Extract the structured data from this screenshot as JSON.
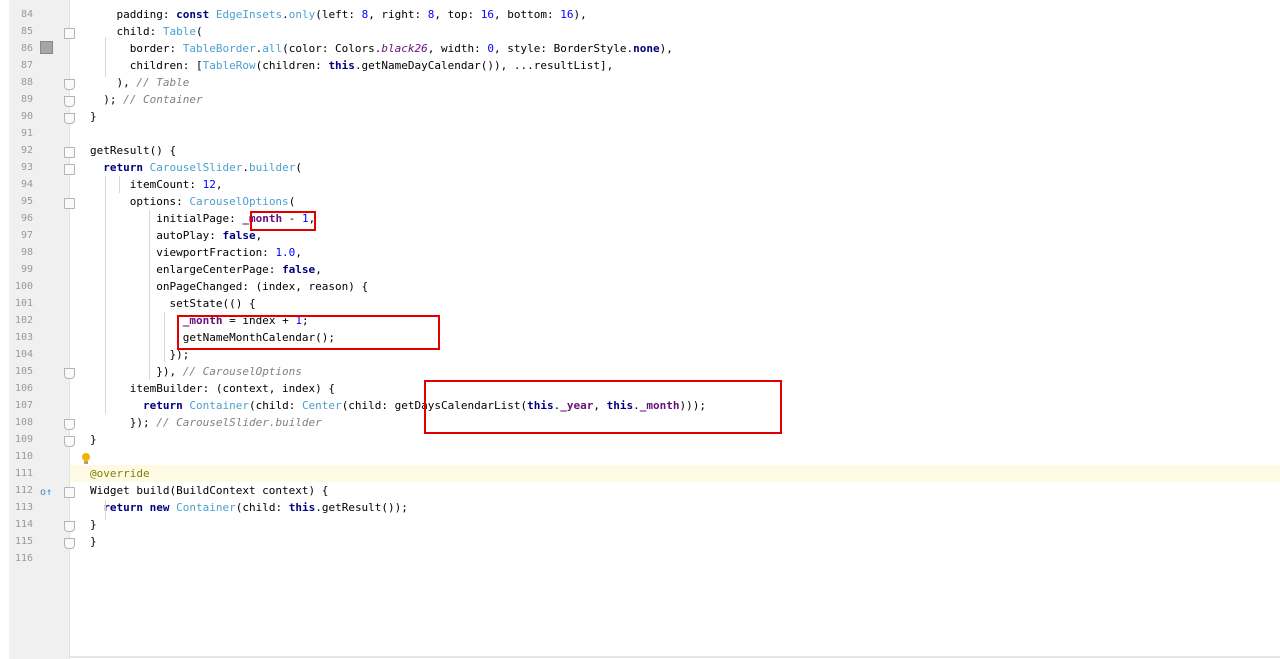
{
  "editor": {
    "lines": [
      {
        "n": "84",
        "segs": [
          [
            "",
            "    padding: "
          ],
          [
            "kw",
            "const "
          ],
          [
            "cls",
            "EdgeInsets"
          ],
          [
            "",
            "."
          ],
          [
            "cls",
            "only"
          ],
          [
            "",
            "(left: "
          ],
          [
            "num",
            "8"
          ],
          [
            "",
            ", right: "
          ],
          [
            "num",
            "8"
          ],
          [
            "",
            ", top: "
          ],
          [
            "num",
            "16"
          ],
          [
            "",
            ", bottom: "
          ],
          [
            "num",
            "16"
          ],
          [
            "",
            "),"
          ]
        ]
      },
      {
        "n": "85",
        "segs": [
          [
            "",
            "    child: "
          ],
          [
            "cls",
            "Table"
          ],
          [
            "",
            "("
          ]
        ]
      },
      {
        "n": "86",
        "segs": [
          [
            "",
            "      border: "
          ],
          [
            "cls",
            "TableBorder"
          ],
          [
            "",
            "."
          ],
          [
            "cls",
            "all"
          ],
          [
            "",
            "(color: Colors."
          ],
          [
            "ital",
            "black26"
          ],
          [
            "",
            ", width: "
          ],
          [
            "num",
            "0"
          ],
          [
            "",
            ", style: BorderStyle."
          ],
          [
            "kw",
            "none"
          ],
          [
            "",
            "),"
          ]
        ]
      },
      {
        "n": "87",
        "segs": [
          [
            "",
            "      children: ["
          ],
          [
            "cls",
            "TableRow"
          ],
          [
            "",
            "(children: "
          ],
          [
            "kw",
            "this"
          ],
          [
            "",
            ".getNameDayCalendar()), ...resultList],"
          ]
        ]
      },
      {
        "n": "88",
        "segs": [
          [
            "",
            "    ), "
          ],
          [
            "cm",
            "// Table"
          ]
        ]
      },
      {
        "n": "89",
        "segs": [
          [
            "",
            "  ); "
          ],
          [
            "cm",
            "// Container"
          ]
        ]
      },
      {
        "n": "90",
        "segs": [
          [
            "",
            "}"
          ]
        ]
      },
      {
        "n": "91",
        "segs": [
          [
            "",
            ""
          ]
        ]
      },
      {
        "n": "92",
        "segs": [
          [
            "",
            "getResult() {"
          ]
        ]
      },
      {
        "n": "93",
        "segs": [
          [
            "",
            "  "
          ],
          [
            "kw",
            "return "
          ],
          [
            "cls",
            "CarouselSlider"
          ],
          [
            "",
            "."
          ],
          [
            "cls",
            "builder"
          ],
          [
            "",
            "("
          ]
        ]
      },
      {
        "n": "94",
        "segs": [
          [
            "",
            "      itemCount: "
          ],
          [
            "num",
            "12"
          ],
          [
            "",
            ","
          ]
        ]
      },
      {
        "n": "95",
        "segs": [
          [
            "",
            "      options: "
          ],
          [
            "cls",
            "CarouselOptions"
          ],
          [
            "",
            "("
          ]
        ]
      },
      {
        "n": "96",
        "segs": [
          [
            "",
            "          initialPage: "
          ],
          [
            "fld",
            "_month"
          ],
          [
            "",
            " - "
          ],
          [
            "num",
            "1"
          ],
          [
            "",
            ","
          ]
        ]
      },
      {
        "n": "97",
        "segs": [
          [
            "",
            "          autoPlay: "
          ],
          [
            "kw",
            "false"
          ],
          [
            "",
            ","
          ]
        ]
      },
      {
        "n": "98",
        "segs": [
          [
            "",
            "          viewportFraction: "
          ],
          [
            "num",
            "1.0"
          ],
          [
            "",
            ","
          ]
        ]
      },
      {
        "n": "99",
        "segs": [
          [
            "",
            "          enlargeCenterPage: "
          ],
          [
            "kw",
            "false"
          ],
          [
            "",
            ","
          ]
        ]
      },
      {
        "n": "100",
        "segs": [
          [
            "",
            "          onPageChanged: (index, reason) {"
          ]
        ]
      },
      {
        "n": "101",
        "segs": [
          [
            "",
            "            setState(() {"
          ]
        ]
      },
      {
        "n": "102",
        "segs": [
          [
            "",
            "              "
          ],
          [
            "fld",
            "_month"
          ],
          [
            "",
            " = index + "
          ],
          [
            "num",
            "1"
          ],
          [
            "",
            ";"
          ]
        ]
      },
      {
        "n": "103",
        "segs": [
          [
            "",
            "              getNameMonthCalendar();"
          ]
        ]
      },
      {
        "n": "104",
        "segs": [
          [
            "",
            "            });"
          ]
        ]
      },
      {
        "n": "105",
        "segs": [
          [
            "",
            "          }), "
          ],
          [
            "cm",
            "// CarouselOptions"
          ]
        ]
      },
      {
        "n": "106",
        "segs": [
          [
            "",
            "      itemBuilder: (context, index) {"
          ]
        ]
      },
      {
        "n": "107",
        "segs": [
          [
            "",
            "        "
          ],
          [
            "kw",
            "return "
          ],
          [
            "cls",
            "Container"
          ],
          [
            "",
            "(child: "
          ],
          [
            "cls",
            "Center"
          ],
          [
            "",
            "(child: getDaysCalendarList("
          ],
          [
            "kw",
            "this"
          ],
          [
            "",
            "."
          ],
          [
            "fld",
            "_year"
          ],
          [
            "",
            ", "
          ],
          [
            "kw",
            "this"
          ],
          [
            "",
            "."
          ],
          [
            "fld",
            "_month"
          ],
          [
            "",
            ")));"
          ]
        ]
      },
      {
        "n": "108",
        "segs": [
          [
            "",
            "      }); "
          ],
          [
            "cm",
            "// CarouselSlider.builder"
          ]
        ]
      },
      {
        "n": "109",
        "segs": [
          [
            "",
            "}"
          ]
        ]
      },
      {
        "n": "110",
        "segs": [
          [
            "",
            ""
          ]
        ]
      },
      {
        "n": "111",
        "segs": [
          [
            "ann",
            "@override"
          ]
        ]
      },
      {
        "n": "112",
        "segs": [
          [
            "",
            "Widget build(BuildContext context) {"
          ]
        ]
      },
      {
        "n": "113",
        "segs": [
          [
            "",
            "  "
          ],
          [
            "kw",
            "return new "
          ],
          [
            "cls",
            "Container"
          ],
          [
            "",
            "(child: "
          ],
          [
            "kw",
            "this"
          ],
          [
            "",
            ".getResult());"
          ]
        ]
      },
      {
        "n": "114",
        "segs": [
          [
            "",
            "}"
          ]
        ]
      },
      {
        "n": "115",
        "segs": [
          [
            "",
            "}"
          ]
        ]
      },
      {
        "n": "116",
        "segs": [
          [
            "",
            ""
          ]
        ]
      }
    ],
    "override_marker": "o↑"
  }
}
